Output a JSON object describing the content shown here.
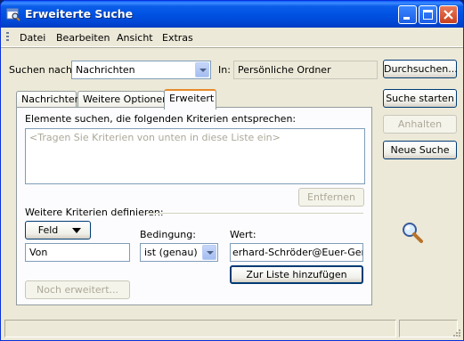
{
  "window": {
    "title": "Erweiterte Suche"
  },
  "menu": [
    "Datei",
    "Bearbeiten",
    "Ansicht",
    "Extras"
  ],
  "search": {
    "look_for_label": "Suchen nach:",
    "look_for_value": "Nachrichten",
    "in_label": "In:",
    "in_value": "Persönliche Ordner",
    "browse_button": "Durchsuchen..."
  },
  "side_buttons": {
    "start": "Suche starten",
    "stop": "Anhalten",
    "new": "Neue Suche"
  },
  "tabs": [
    {
      "label": "Nachrichten",
      "active": false
    },
    {
      "label": "Weitere Optionen",
      "active": false
    },
    {
      "label": "Erweitert",
      "active": true
    }
  ],
  "advanced": {
    "criteria_heading": "Elemente suchen, die folgenden Kriterien entsprechen:",
    "criteria_placeholder": "<Tragen Sie Kriterien von unten in diese Liste ein>",
    "remove_button": "Entfernen",
    "define_heading": "Weitere Kriterien definieren:",
    "field_button": "Feld",
    "condition_label": "Bedingung:",
    "value_label": "Wert:",
    "field_value": "Von",
    "condition_value": "ist (genau)",
    "value_value": "erhard-Schröder@Euer-Gerd.",
    "add_button": "Zur Liste hinzufügen",
    "more_button": "Noch erweitert..."
  },
  "colors": {
    "titlebar": "#0052e3",
    "window_bg": "#ece9d8",
    "active_tab_accent": "#e68b2c"
  },
  "icons": {
    "app": "search-window-icon",
    "search": "magnifier-icon"
  }
}
